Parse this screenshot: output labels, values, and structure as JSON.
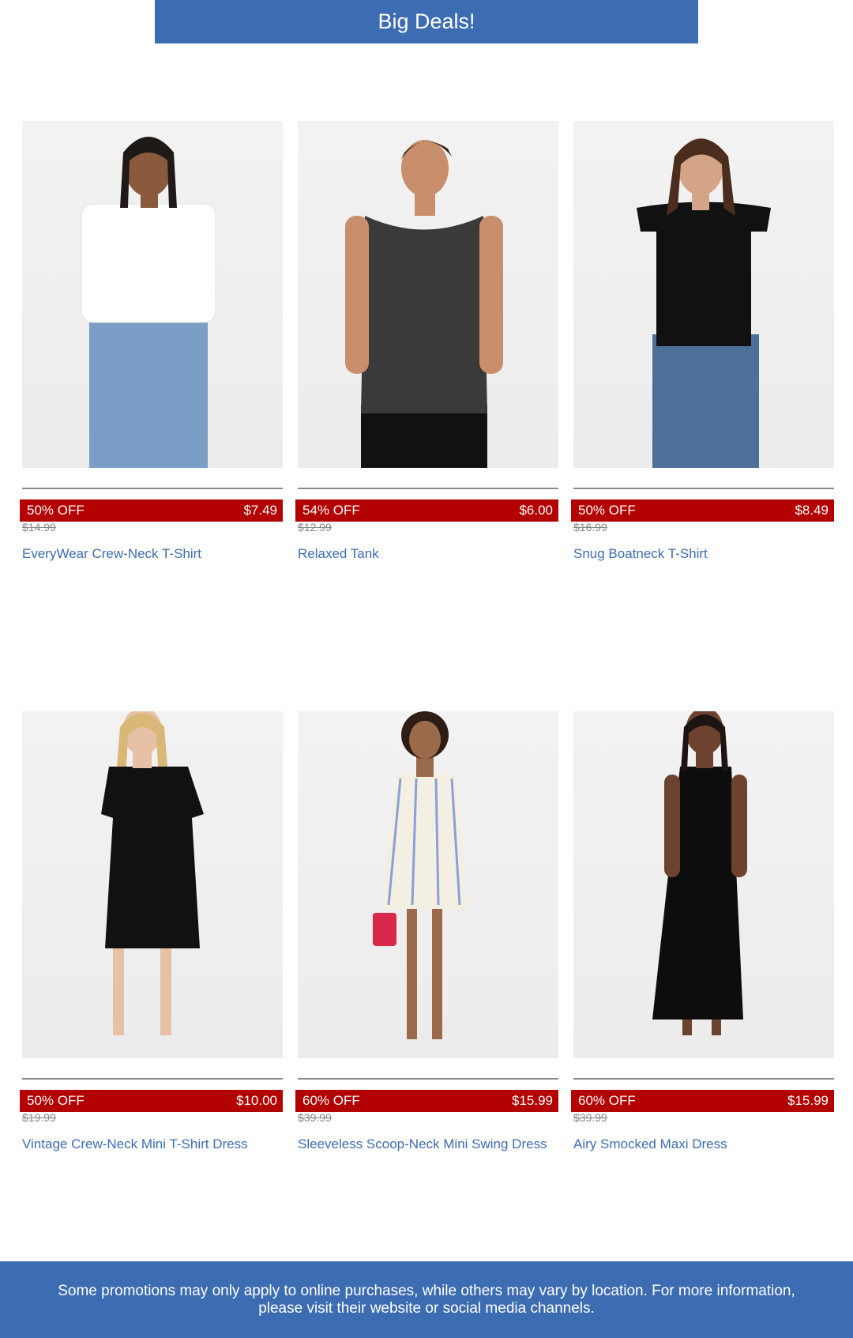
{
  "header": {
    "title": "Big Deals!"
  },
  "products": [
    {
      "discount": "50% OFF",
      "price": "$7.49",
      "original_price": "$14.99",
      "name": "EveryWear Crew-Neck T-Shirt"
    },
    {
      "discount": "54% OFF",
      "price": "$6.00",
      "original_price": "$12.99",
      "name": "Relaxed Tank"
    },
    {
      "discount": "50% OFF",
      "price": "$8.49",
      "original_price": "$16.99",
      "name": "Snug Boatneck T-Shirt"
    },
    {
      "discount": "50% OFF",
      "price": "$10.00",
      "original_price": "$19.99",
      "name": "Vintage Crew-Neck Mini T-Shirt Dress"
    },
    {
      "discount": "60% OFF",
      "price": "$15.99",
      "original_price": "$39.99",
      "name": "Sleeveless Scoop-Neck Mini Swing Dress"
    },
    {
      "discount": "60% OFF",
      "price": "$15.99",
      "original_price": "$39.99",
      "name": "Airy Smocked Maxi Dress"
    }
  ],
  "footer": {
    "text": "Some promotions may only apply to online purchases, while others may vary by location. For more information, please visit their website or social media channels."
  },
  "colors": {
    "brand_blue": "#3c6cb1",
    "deal_red": "#b30000"
  }
}
